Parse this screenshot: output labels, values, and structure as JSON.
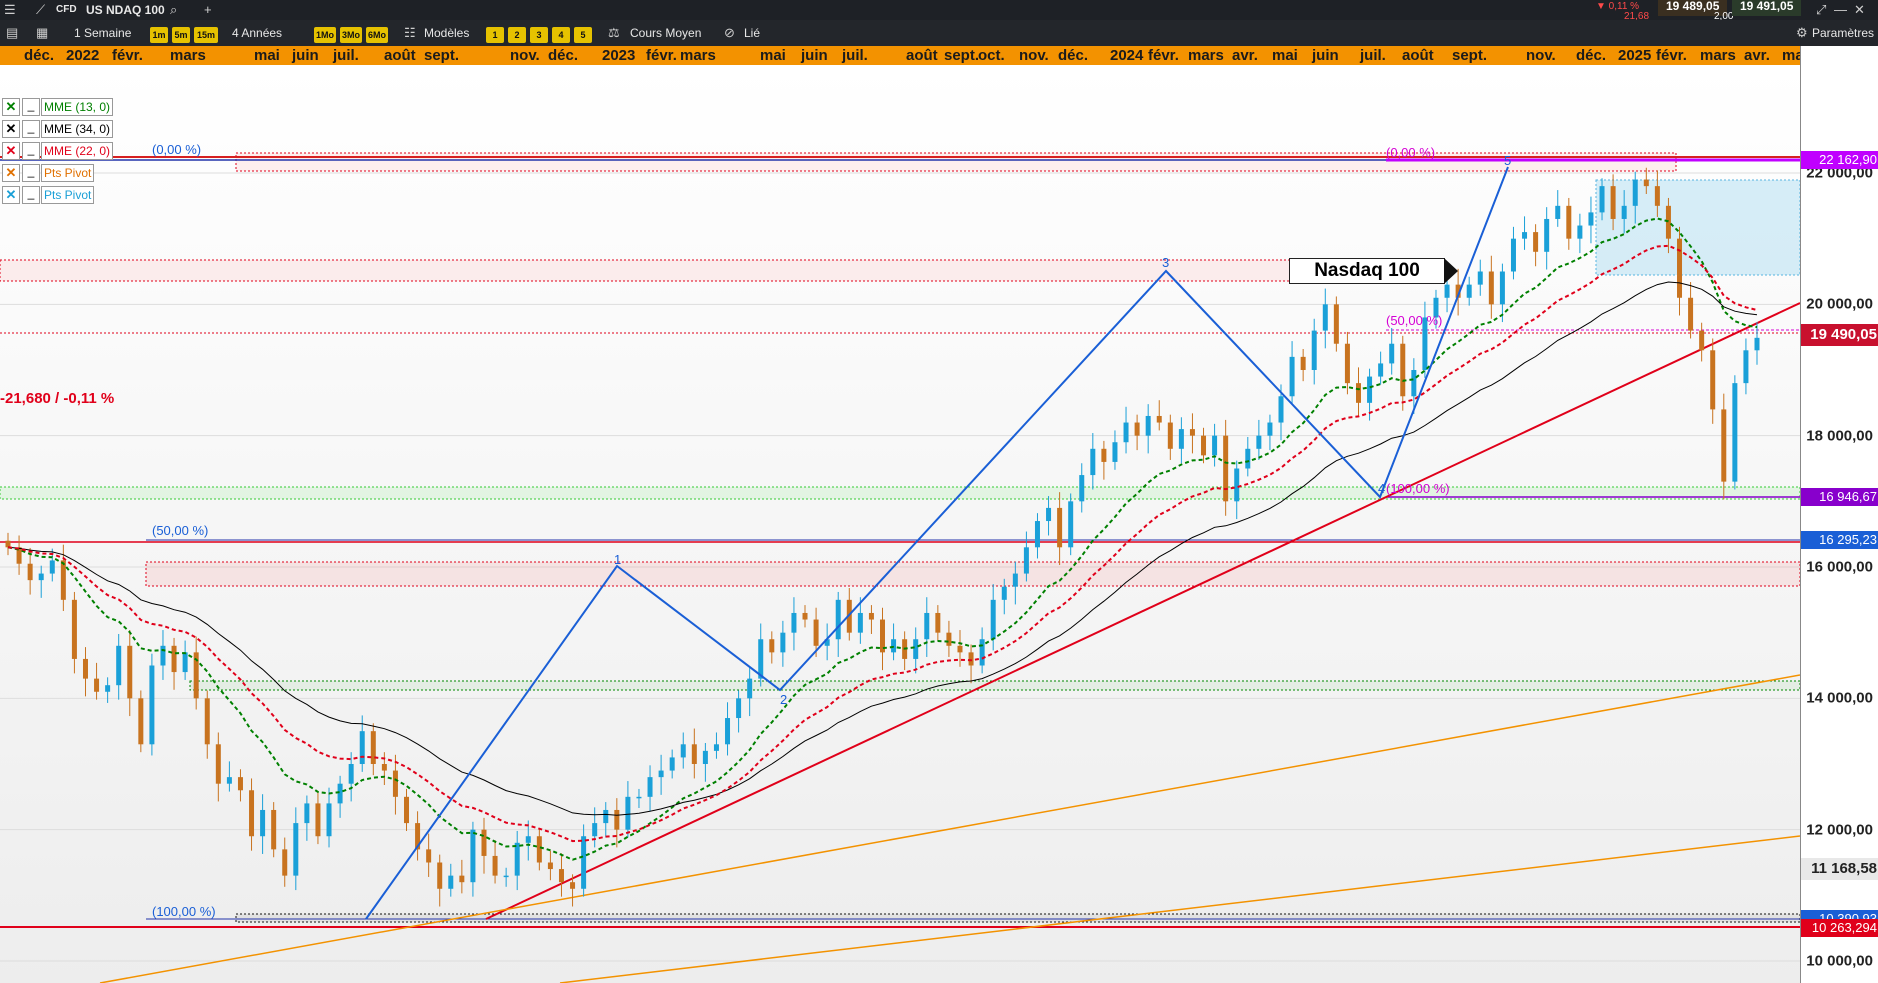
{
  "header": {
    "instrument_type": "CFD",
    "instrument_name": "US NDAQ 100",
    "change_pct": "▼ 0,11 %",
    "change_abs": "21,68",
    "bid": "19 489,05",
    "spread": "2,00",
    "ask": "19 491,05"
  },
  "toolbar": {
    "interval": "1 Semaine",
    "timeframes": [
      "1m",
      "5m",
      "15m"
    ],
    "range": "4 Années",
    "periods": [
      "1Mo",
      "3Mo",
      "6Mo"
    ],
    "templates_label": "Modèles",
    "layouts": [
      "1",
      "2",
      "3",
      "4",
      "5"
    ],
    "price_type": "Cours Moyen",
    "linked_label": "Lié",
    "settings_label": "Paramètres"
  },
  "legend": [
    {
      "label": "MME (13, 0)",
      "color": "#008000",
      "mark": "✕"
    },
    {
      "label": "MME (34, 0)",
      "color": "#000000",
      "mark": "✕"
    },
    {
      "label": "MME (22, 0)",
      "color": "#e0001a",
      "mark": "✕"
    },
    {
      "label": "Pts Pivot",
      "color": "#e07000",
      "mark": "✕"
    },
    {
      "label": "Pts Pivot",
      "color": "#1a9fd6",
      "mark": "✕"
    }
  ],
  "annotations": {
    "title": "Nasdaq 100",
    "price_change": "-21,680 / -0,11 %",
    "fib_left_0": "(0,00 %)",
    "fib_left_50": "(50,00 %)",
    "fib_left_100": "(100,00 %)",
    "fib_right_0": "(0,00 %)",
    "fib_right_50": "(50,00 %)",
    "fib_right_100": "(100,00 %)",
    "wave_labels": [
      "1",
      "2",
      "3",
      "4",
      "5"
    ]
  },
  "y_axis": {
    "current_price": "19 490,05",
    "marker_high": "22 162,90",
    "marker_pivot": "16 946,67",
    "marker_support": "16 295,23",
    "marker_mid": "11 168,58",
    "marker_low1": "10 390,93",
    "marker_low2": "10 263,294",
    "tick_labels": [
      "22 000,00",
      "20 000,00",
      "18 000,00",
      "16 000,00",
      "14 000,00",
      "12 000,00",
      "10 000,00"
    ]
  },
  "chart_data": {
    "type": "candlestick",
    "title": "Nasdaq 100",
    "period": "weekly",
    "x_month_labels": [
      "déc.",
      "2022",
      "févr.",
      "mars",
      "mai",
      "juin",
      "juil.",
      "août",
      "sept.",
      "nov.",
      "déc.",
      "2023",
      "févr.",
      "mars",
      "mai",
      "juin",
      "juil.",
      "août",
      "sept.",
      "oct.",
      "nov.",
      "déc.",
      "2024",
      "févr.",
      "mars",
      "avr.",
      "mai",
      "juin",
      "juil.",
      "août",
      "sept.",
      "nov.",
      "déc.",
      "2025",
      "févr.",
      "mars",
      "avr.",
      "mai"
    ],
    "y_ticks": [
      10000,
      12000,
      14000,
      16000,
      18000,
      20000,
      22000
    ],
    "ylim": [
      9700,
      23200
    ],
    "closes": [
      16300,
      16050,
      15800,
      15900,
      16100,
      15500,
      14600,
      14300,
      14100,
      14200,
      14800,
      14000,
      13300,
      14500,
      14800,
      14400,
      14700,
      14000,
      13300,
      12700,
      12800,
      12600,
      11900,
      12300,
      11700,
      11300,
      12100,
      12400,
      11900,
      12400,
      12700,
      13000,
      13500,
      13000,
      12900,
      12500,
      12100,
      11700,
      11500,
      11100,
      11300,
      11200,
      12000,
      11600,
      11300,
      11300,
      11800,
      11900,
      11500,
      11400,
      11200,
      11100,
      11900,
      12100,
      12300,
      12000,
      12500,
      12500,
      12800,
      12900,
      13100,
      13300,
      13000,
      13200,
      13300,
      13700,
      14000,
      14300,
      14900,
      14700,
      15000,
      15300,
      15200,
      14800,
      14900,
      15500,
      15000,
      15300,
      15200,
      14700,
      14900,
      14600,
      14900,
      15300,
      15000,
      14800,
      14700,
      14500,
      14900,
      15500,
      15700,
      15900,
      16300,
      16700,
      16900,
      16300,
      17000,
      17400,
      17800,
      17600,
      17900,
      18200,
      18000,
      18300,
      18200,
      17800,
      18100,
      18000,
      17700,
      18000,
      17000,
      17500,
      17800,
      18000,
      18200,
      18600,
      19200,
      19000,
      19600,
      20000,
      19400,
      18800,
      18500,
      18900,
      19100,
      19400,
      18600,
      19000,
      19800,
      20100,
      20300,
      20100,
      20300,
      20500,
      20000,
      20500,
      21000,
      21100,
      20800,
      21300,
      21500,
      21000,
      21200,
      21400,
      21800,
      21300,
      21500,
      21900,
      21800,
      21500,
      21000,
      20100,
      19600,
      19300,
      18400,
      17300,
      18800,
      19300,
      19490
    ],
    "series": [
      {
        "name": "MME (13, 0)",
        "color": "#008000"
      },
      {
        "name": "MME (34, 0)",
        "color": "#000000"
      },
      {
        "name": "MME (22, 0)",
        "color": "#e0001a"
      }
    ],
    "horizontal_levels": [
      22162.9,
      16946.67,
      16295.23,
      10390.93,
      10263.294
    ],
    "current_price": 19490.05
  }
}
